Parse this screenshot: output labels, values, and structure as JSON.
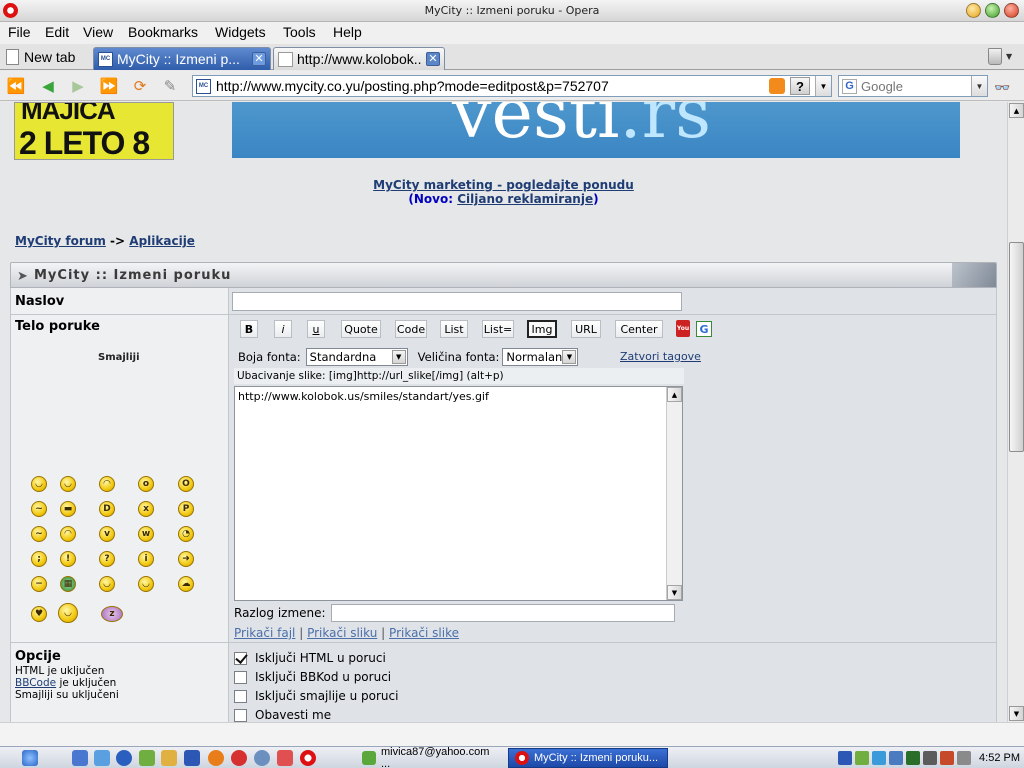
{
  "window": {
    "title": "MyCity :: Izmeni poruku - Opera"
  },
  "menu": [
    "File",
    "Edit",
    "View",
    "Bookmarks",
    "Widgets",
    "Tools",
    "Help"
  ],
  "tabs": {
    "new_tab": "New tab",
    "items": [
      {
        "label": "MyCity :: Izmeni p...",
        "active": true
      },
      {
        "label": "http://www.kolobok...",
        "active": false
      }
    ]
  },
  "address": {
    "url": "http://www.mycity.co.yu/posting.php?mode=editpost&p=752707",
    "help_label": "?",
    "search_placeholder": "Google"
  },
  "banners": {
    "left_line1": "MAJICA",
    "left_line2": "2 LETO 8",
    "main_logo": "vesti",
    "main_logo_suffix": ".rs"
  },
  "marketing": {
    "link": "MyCity marketing - pogledajte ponudu",
    "novo_prefix": "(Novo: ",
    "novo_link": "Ciljano reklamiranje",
    "novo_suffix": ")"
  },
  "breadcrumb": {
    "forum": "MyCity forum",
    "separator": "->",
    "section": "Aplikacije"
  },
  "panel": {
    "title": "MyCity :: Izmeni poruku"
  },
  "form": {
    "subject_label": "Naslov",
    "subject_value": "",
    "body_label": "Telo poruke",
    "smileys_title": "Smajliji",
    "toolbar": [
      "B",
      "i",
      "u",
      "Quote",
      "Code",
      "List",
      "List=",
      "Img",
      "URL",
      "Center"
    ],
    "font_color_label": "Boja fonta:",
    "font_color_value": "Standardna",
    "font_size_label": "Veličina fonta:",
    "font_size_value": "Normalan",
    "close_tags": "Zatvori tagove",
    "hint": "Ubacivanje slike: [img]http://url_slike[/img]  (alt+p)",
    "body_value": "http://www.kolobok.us/smiles/standart/yes.gif",
    "reason_label": "Razlog izmene:",
    "reason_value": "",
    "attach": [
      "Prikači fajl",
      "Prikači sliku",
      "Prikači slike"
    ],
    "attach_sep": "|"
  },
  "options": {
    "title": "Opcije",
    "html_status": "HTML je uključen",
    "bbcode_link": "BBCode",
    "bbcode_suffix": " je uključen",
    "smileys_status": "Smajliji su uključeni",
    "checkboxes": [
      {
        "label": "Isključi HTML u poruci",
        "checked": true
      },
      {
        "label": "Isključi BBKod u poruci",
        "checked": false
      },
      {
        "label": "Isključi smajlije u poruci",
        "checked": false
      },
      {
        "label": "Obavesti me",
        "checked": false
      }
    ]
  },
  "taskbar": {
    "tasks": [
      {
        "label": "mivica87@yahoo.com ...",
        "active": false
      },
      {
        "label": "MyCity :: Izmeni poruku...",
        "active": true
      }
    ],
    "clock": "4:52 PM"
  },
  "colors": {
    "tab_active": "#2f5dab",
    "link": "#1f3d74",
    "banner_blue": "#4e97cd"
  }
}
